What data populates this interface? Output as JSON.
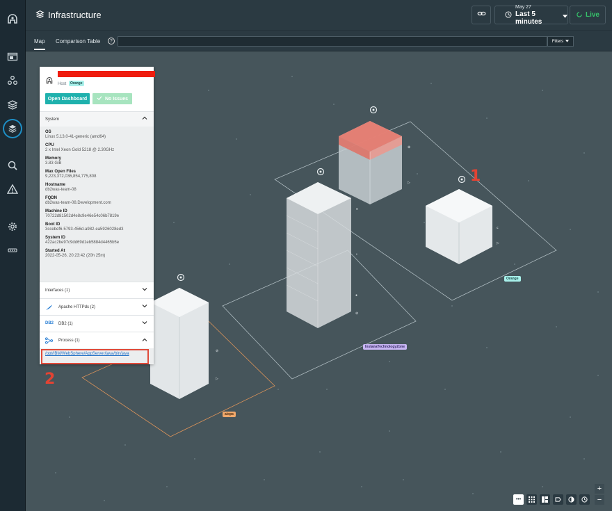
{
  "app": {
    "title": "Infrastructure"
  },
  "header": {
    "time_date": "May 27",
    "time_range": "Last 5 minutes",
    "live_label": "Live"
  },
  "tabs": [
    {
      "label": "Map",
      "active": true
    },
    {
      "label": "Comparison Table",
      "active": false
    }
  ],
  "search": {
    "placeholder": "",
    "filters_label": "Filters"
  },
  "sidebar": {
    "items": [
      {
        "icon": "logo-icon"
      },
      {
        "icon": "websites-icon"
      },
      {
        "icon": "applications-icon"
      },
      {
        "icon": "platforms-icon"
      },
      {
        "icon": "infrastructure-icon",
        "active": true
      },
      {
        "icon": "analytics-icon"
      },
      {
        "icon": "events-icon"
      },
      {
        "icon": "settings-icon"
      },
      {
        "icon": "more-icon"
      }
    ]
  },
  "panel": {
    "entity_type": "Host",
    "zone_tag": "Orange",
    "open_dashboard_label": "Open Dashboard",
    "no_issues_label": "No Issues",
    "system_label": "System",
    "properties": [
      {
        "key": "OS",
        "value": "Linux 5.13.0-41-generic (amd64)"
      },
      {
        "key": "CPU",
        "value": "2 x Intel Xeon Gold 5218 @ 2.30GHz"
      },
      {
        "key": "Memory",
        "value": "3.83 GiB"
      },
      {
        "key": "Max Open Files",
        "value": "9,223,372,036,854,775,808"
      },
      {
        "key": "Hostname",
        "value": "db2was-team-08"
      },
      {
        "key": "FQDN",
        "value": "db2was-team-08.Development.com"
      },
      {
        "key": "Machine ID",
        "value": "70722d81502d4e8c9e46e54c06b7819e"
      },
      {
        "key": "Boot ID",
        "value": "3ccebef6-5793-456d-a982-ea5926028ed3"
      },
      {
        "key": "System ID",
        "value": "422ac2be97c9dd69d1eb5884d4465b5e"
      },
      {
        "key": "Started At",
        "value": "2022-05-26, 20:23:42 (20h 25m)"
      }
    ],
    "sections": [
      {
        "label": "Interfaces (1)",
        "icon": "none"
      },
      {
        "label": "Apache HTTPds (2)",
        "icon": "apache-feather-icon"
      },
      {
        "label": "DB2 (1)",
        "icon": "db2-icon",
        "icon_text": "DB2"
      },
      {
        "label": "Process (1)",
        "icon": "process-icon"
      }
    ],
    "process_link": "/opt/IBM/WebSphere/AppServer/java/bin/java"
  },
  "map": {
    "zones": [
      {
        "label": "Orange",
        "color": "#a8f0ea"
      },
      {
        "label": "InstanaTechnologyZone",
        "color": "#c7b5f2"
      },
      {
        "label": "aiops",
        "color": "#f0a86b"
      }
    ]
  },
  "annotations": {
    "one": "1",
    "two": "2"
  },
  "colors": {
    "accent": "#1fb1ad",
    "live": "#36c46b",
    "annotation": "#e24333",
    "alert": "#ef1c0e"
  }
}
